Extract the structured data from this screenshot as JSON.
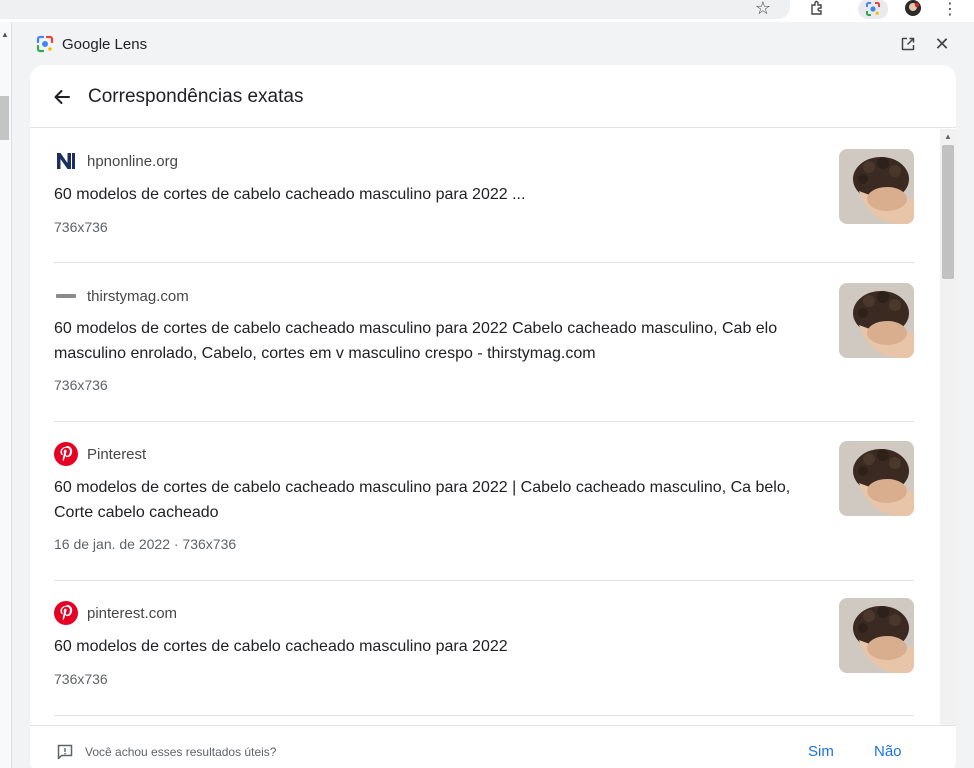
{
  "panel": {
    "title": "Google Lens"
  },
  "card": {
    "title": "Correspondências exatas"
  },
  "results": [
    {
      "source": "hpnonline.org",
      "favicon": "hpnonline-icon",
      "title": "60 modelos de cortes de cabelo cacheado masculino para 2022 ...",
      "meta": "736x736"
    },
    {
      "source": "thirstymag.com",
      "favicon": "thirstymag-icon",
      "title": "60 modelos de cortes de cabelo cacheado masculino para 2022 Cabelo cacheado masculino, Cab elo masculino enrolado, Cabelo, cortes em v masculino crespo - thirstymag.com",
      "meta": "736x736"
    },
    {
      "source": "Pinterest",
      "favicon": "pinterest-icon",
      "title": "60 modelos de cortes de cabelo cacheado masculino para 2022 | Cabelo cacheado masculino, Ca belo, Corte cabelo cacheado",
      "meta": "16 de jan. de 2022 · 736x736"
    },
    {
      "source": "pinterest.com",
      "favicon": "pinterest-icon",
      "title": "60 modelos de cortes de cabelo cacheado masculino para 2022",
      "meta": "736x736"
    }
  ],
  "feedback": {
    "question": "Você achou esses resultados úteis?",
    "yes_label": "Sim",
    "no_label": "Não"
  },
  "colors": {
    "accent": "#1a73e8",
    "pinterest": "#e60023",
    "hpn_navy": "#1c2f5e"
  }
}
